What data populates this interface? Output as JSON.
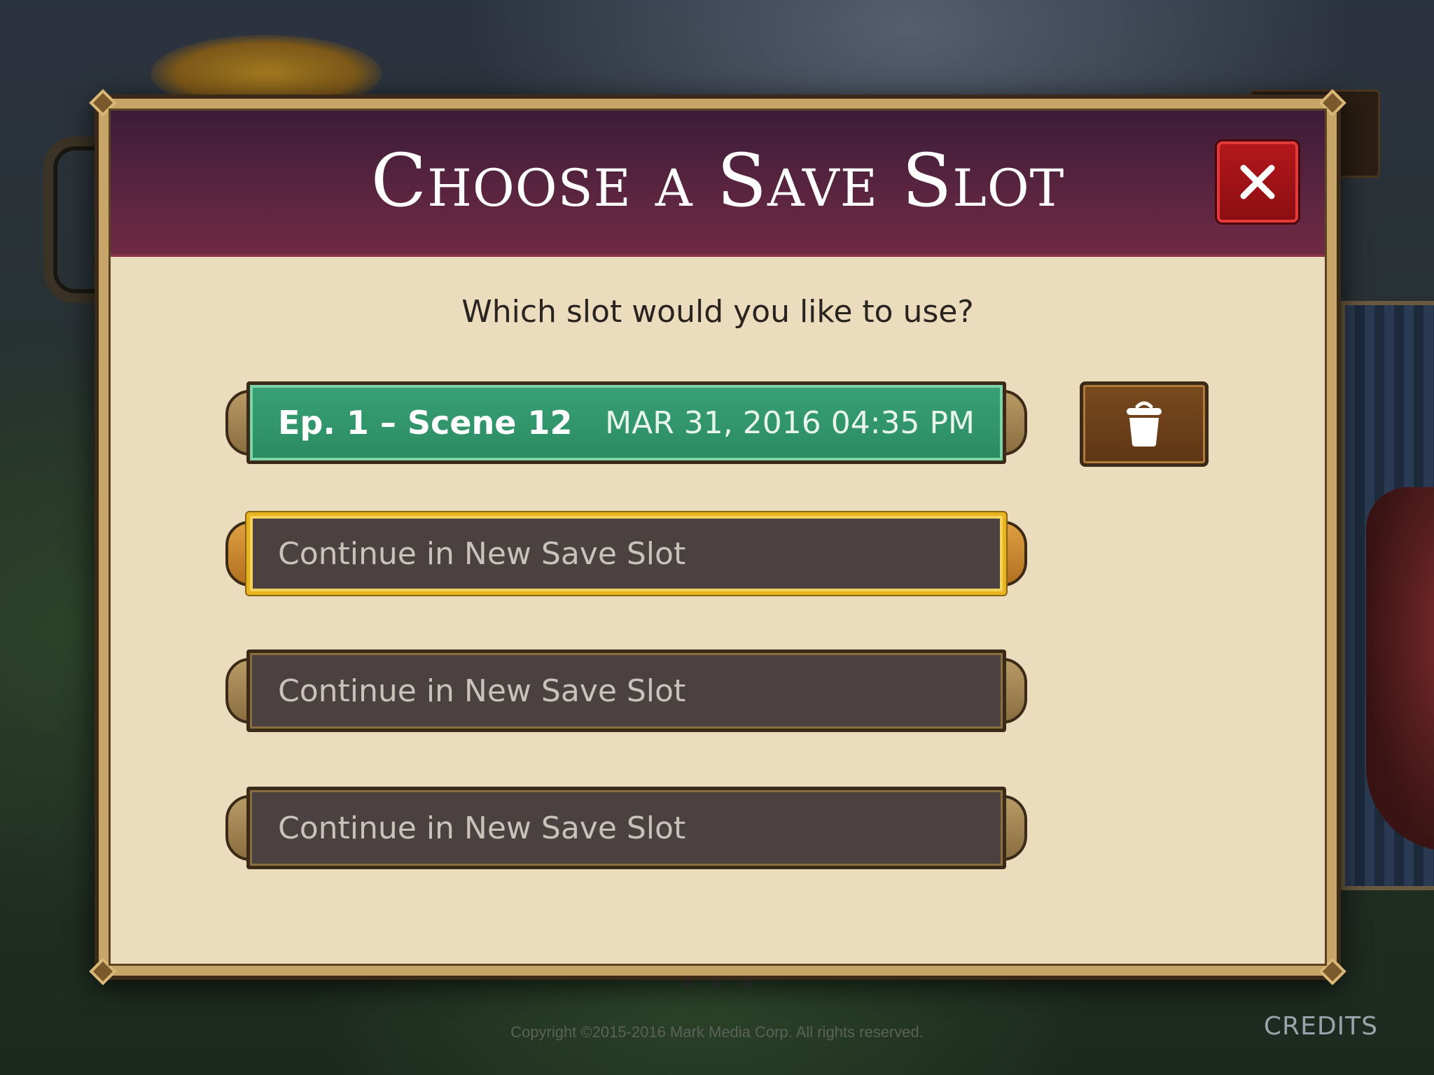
{
  "dialog": {
    "title": "Choose a Save Slot",
    "prompt": "Which slot would you like to use?"
  },
  "slots": [
    {
      "scene": "Ep. 1 – Scene 12",
      "date": "MAR 31, 2016  04:35 PM",
      "state": "filled"
    },
    {
      "label": "Continue in New Save Slot",
      "state": "empty-selected"
    },
    {
      "label": "Continue in New Save Slot",
      "state": "empty"
    },
    {
      "label": "Continue in New Save Slot",
      "state": "empty"
    }
  ],
  "footer": {
    "copyright": "Copyright ©2015-2016 Mark Media Corp. All rights reserved.",
    "credits": "CREDITS"
  },
  "icons": {
    "close": "close-icon",
    "delete": "trash-icon"
  },
  "colors": {
    "header": "#5c2540",
    "panel": "#ecdcbe",
    "filled_slot": "#2a8a61",
    "empty_slot": "#4a4140",
    "selected_border": "#e8b420",
    "close_button": "#b3171b",
    "delete_button": "#6a3e18"
  }
}
